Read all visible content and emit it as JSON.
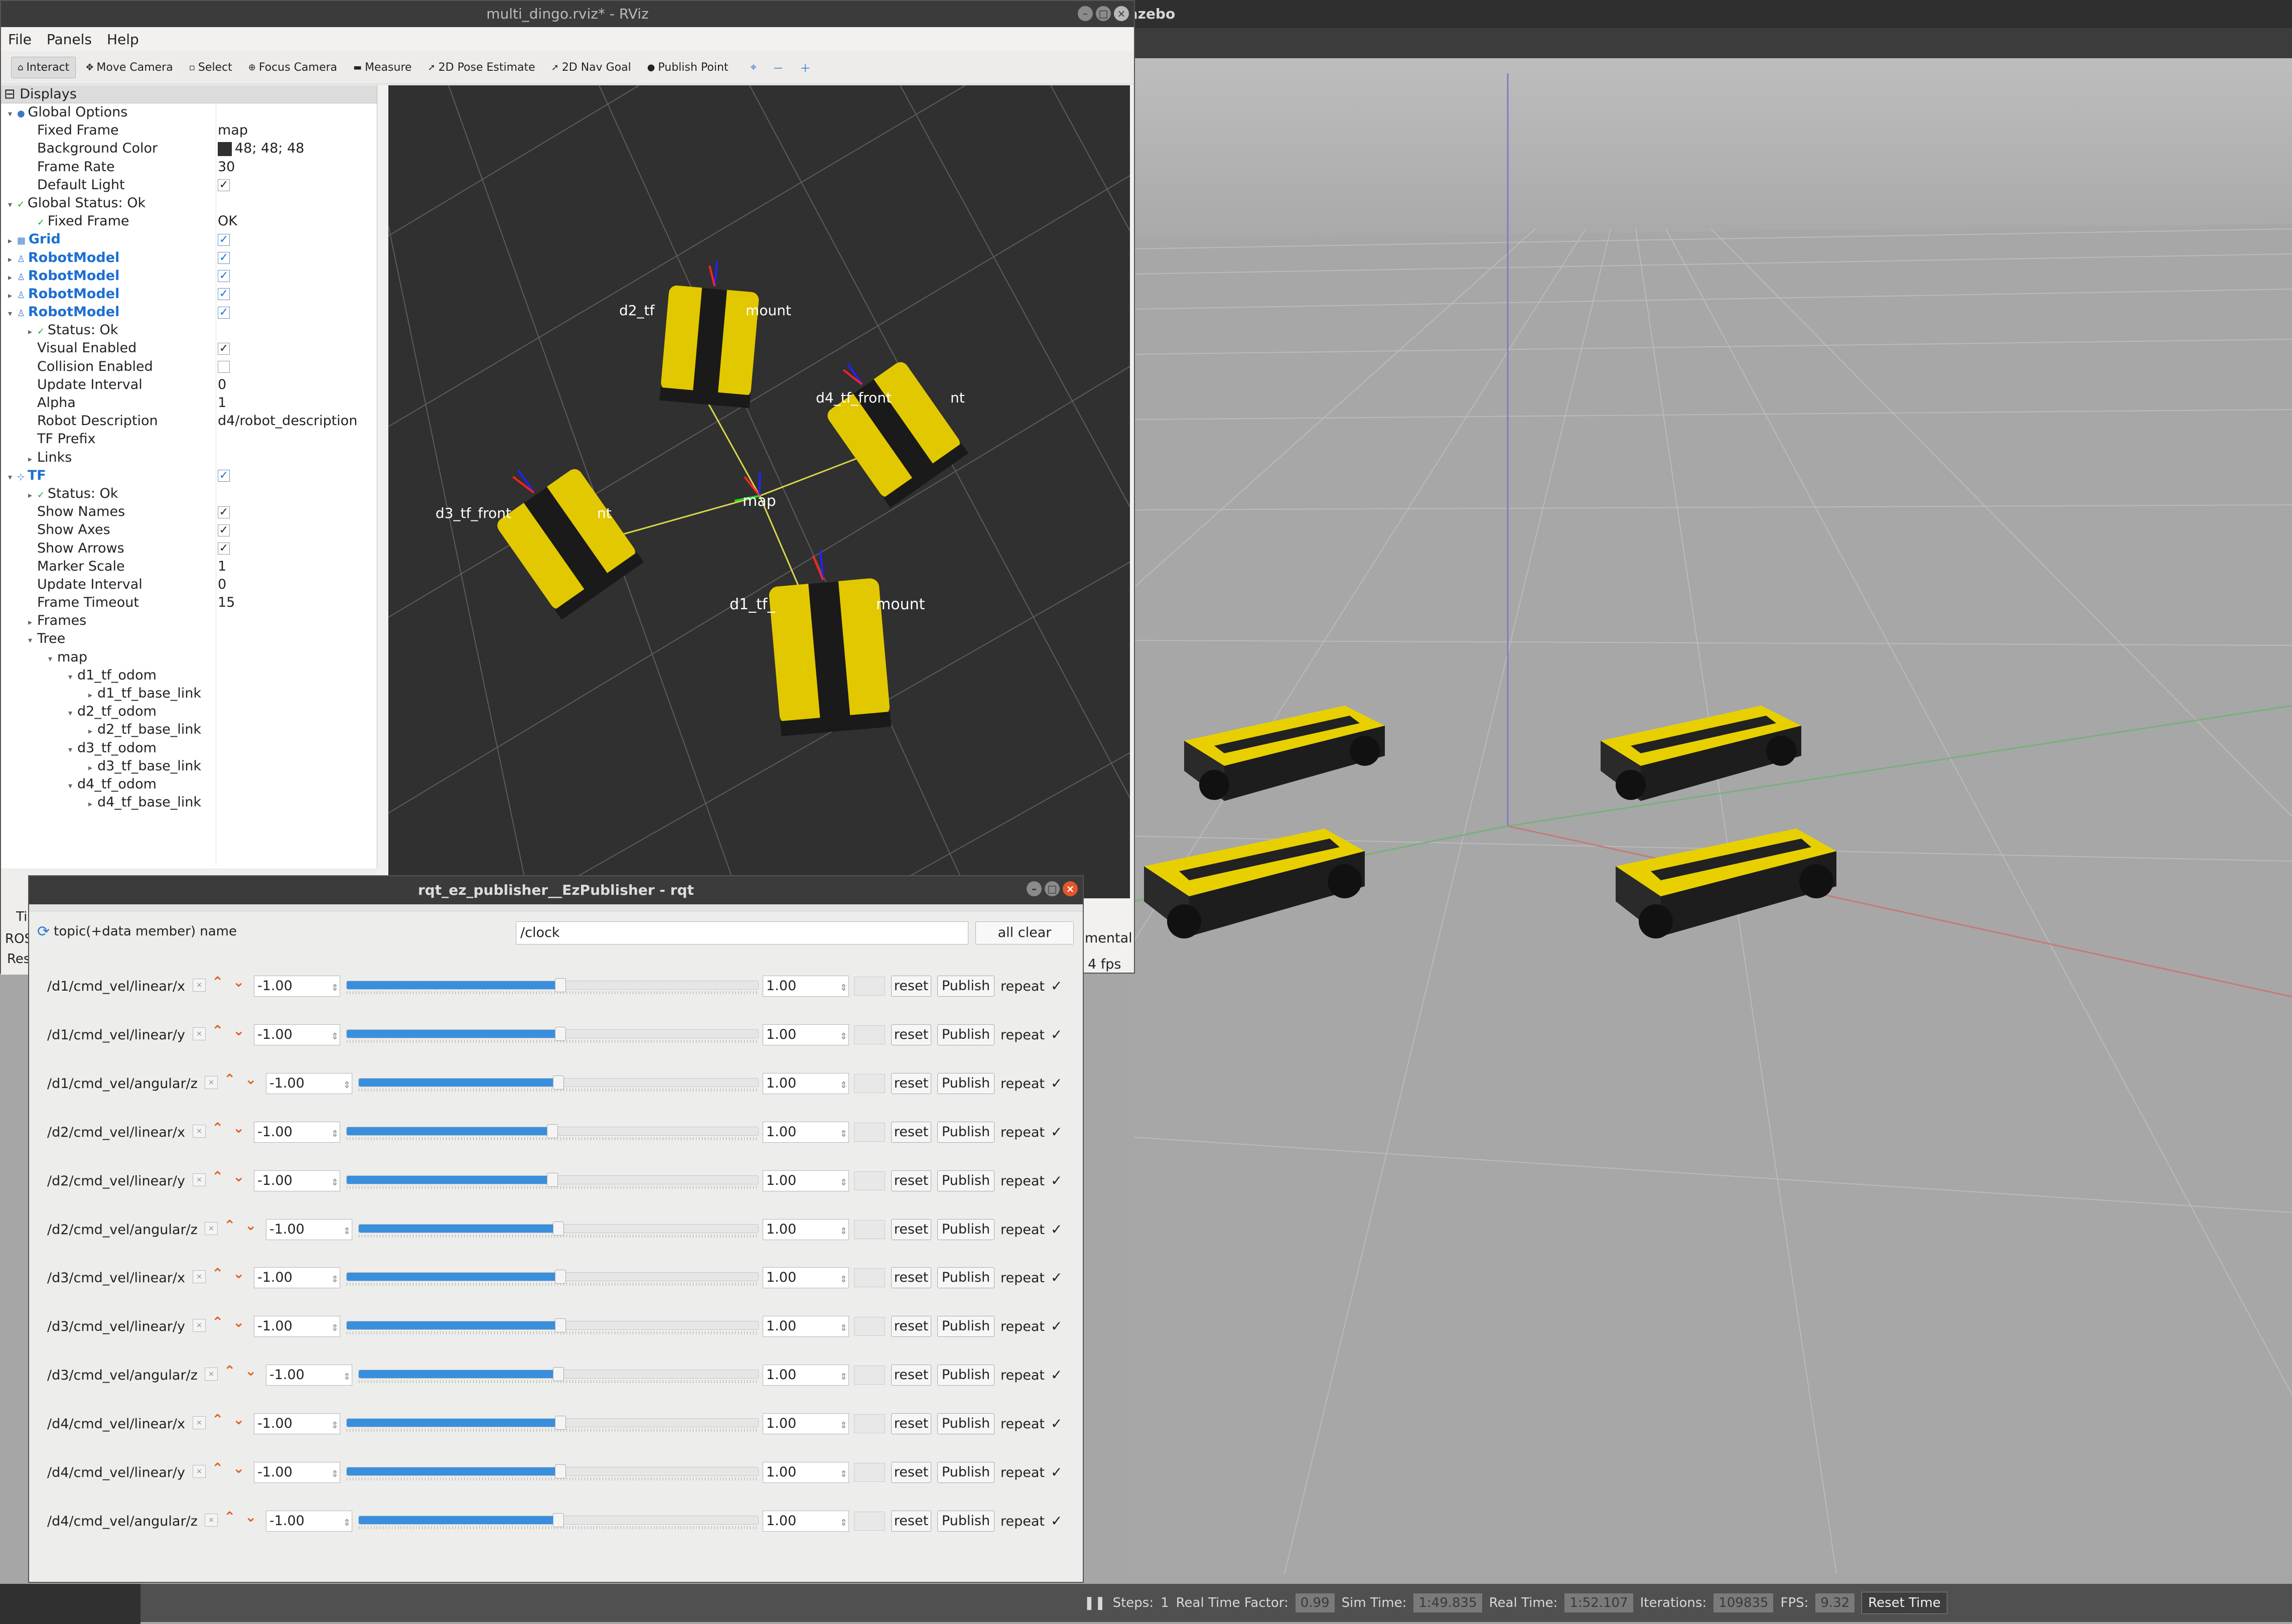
{
  "gazebo": {
    "title": "Gazebo",
    "status": {
      "steps_label": "Steps:",
      "steps_value": "1",
      "rtf_label": "Real Time Factor:",
      "rtf_value": "0.99",
      "sim_label": "Sim Time:",
      "sim_value": "1:49.835",
      "real_label": "Real Time:",
      "real_value": "1:52.107",
      "iter_label": "Iterations:",
      "iter_value": "109835",
      "fps_label": "FPS:",
      "fps_value": "9.32",
      "reset_label": "Reset Time"
    }
  },
  "rviz": {
    "title": "multi_dingo.rviz* - RViz",
    "menu": [
      "File",
      "Panels",
      "Help"
    ],
    "tools": [
      {
        "label": "Interact",
        "icon": "interact-icon",
        "glyph": "⌂"
      },
      {
        "label": "Move Camera",
        "icon": "move-camera-icon",
        "glyph": "✥"
      },
      {
        "label": "Select",
        "icon": "select-icon",
        "glyph": "▫"
      },
      {
        "label": "Focus Camera",
        "icon": "focus-camera-icon",
        "glyph": "⊕"
      },
      {
        "label": "Measure",
        "icon": "measure-icon",
        "glyph": "▬"
      },
      {
        "label": "2D Pose Estimate",
        "icon": "pose-estimate-icon",
        "glyph": "➚"
      },
      {
        "label": "2D Nav Goal",
        "icon": "nav-goal-icon",
        "glyph": "➚"
      },
      {
        "label": "Publish Point",
        "icon": "publish-point-icon",
        "glyph": "●"
      }
    ],
    "displays_title": "Displays",
    "displays": [
      {
        "k": "Global Options",
        "v": "",
        "indent": 0,
        "tri": "▾",
        "ico": "●"
      },
      {
        "k": "Fixed Frame",
        "v": "map",
        "indent": 2
      },
      {
        "k": "Background Color",
        "v": "48; 48; 48",
        "indent": 2,
        "swatch": true
      },
      {
        "k": "Frame Rate",
        "v": "30",
        "indent": 2
      },
      {
        "k": "Default Light",
        "v": "",
        "indent": 2,
        "check": true
      },
      {
        "k": "Global Status: Ok",
        "v": "",
        "indent": 0,
        "tri": "▾",
        "ico": "✓"
      },
      {
        "k": "Fixed Frame",
        "v": "OK",
        "indent": 2,
        "ico": "✓"
      },
      {
        "k": "Grid",
        "v": "",
        "indent": 0,
        "tri": "▸",
        "ico": "▦",
        "blue": true,
        "check": true
      },
      {
        "k": "RobotModel",
        "v": "",
        "indent": 0,
        "tri": "▸",
        "ico": "♙",
        "blue": true,
        "check": true
      },
      {
        "k": "RobotModel",
        "v": "",
        "indent": 0,
        "tri": "▸",
        "ico": "♙",
        "blue": true,
        "check": true
      },
      {
        "k": "RobotModel",
        "v": "",
        "indent": 0,
        "tri": "▸",
        "ico": "♙",
        "blue": true,
        "check": true
      },
      {
        "k": "RobotModel",
        "v": "",
        "indent": 0,
        "tri": "▾",
        "ico": "♙",
        "blue": true,
        "check": true
      },
      {
        "k": "Status: Ok",
        "v": "",
        "indent": 2,
        "tri": "▸",
        "ico": "✓"
      },
      {
        "k": "Visual Enabled",
        "v": "",
        "indent": 2,
        "check": true
      },
      {
        "k": "Collision Enabled",
        "v": "",
        "indent": 2,
        "check": false
      },
      {
        "k": "Update Interval",
        "v": "0",
        "indent": 2
      },
      {
        "k": "Alpha",
        "v": "1",
        "indent": 2
      },
      {
        "k": "Robot Description",
        "v": "d4/robot_description",
        "indent": 2
      },
      {
        "k": "TF Prefix",
        "v": "",
        "indent": 2
      },
      {
        "k": "Links",
        "v": "",
        "indent": 2,
        "tri": "▸"
      },
      {
        "k": "TF",
        "v": "",
        "indent": 0,
        "tri": "▾",
        "ico": "⊹",
        "blue": true,
        "check": true
      },
      {
        "k": "Status: Ok",
        "v": "",
        "indent": 2,
        "tri": "▸",
        "ico": "✓"
      },
      {
        "k": "Show Names",
        "v": "",
        "indent": 2,
        "check": true
      },
      {
        "k": "Show Axes",
        "v": "",
        "indent": 2,
        "check": true
      },
      {
        "k": "Show Arrows",
        "v": "",
        "indent": 2,
        "check": true
      },
      {
        "k": "Marker Scale",
        "v": "1",
        "indent": 2
      },
      {
        "k": "Update Interval",
        "v": "0",
        "indent": 2
      },
      {
        "k": "Frame Timeout",
        "v": "15",
        "indent": 2
      },
      {
        "k": "Frames",
        "v": "",
        "indent": 2,
        "tri": "▸"
      },
      {
        "k": "Tree",
        "v": "",
        "indent": 2,
        "tri": "▾"
      },
      {
        "k": "map",
        "v": "",
        "indent": 4,
        "tri": "▾"
      },
      {
        "k": "d1_tf_odom",
        "v": "",
        "indent": 6,
        "tri": "▾"
      },
      {
        "k": "d1_tf_base_link",
        "v": "",
        "indent": 8,
        "tri": "▸"
      },
      {
        "k": "d2_tf_odom",
        "v": "",
        "indent": 6,
        "tri": "▾"
      },
      {
        "k": "d2_tf_base_link",
        "v": "",
        "indent": 8,
        "tri": "▸"
      },
      {
        "k": "d3_tf_odom",
        "v": "",
        "indent": 6,
        "tri": "▾"
      },
      {
        "k": "d3_tf_base_link",
        "v": "",
        "indent": 8,
        "tri": "▸"
      },
      {
        "k": "d4_tf_odom",
        "v": "",
        "indent": 6,
        "tri": "▾"
      },
      {
        "k": "d4_tf_base_link",
        "v": "",
        "indent": 8,
        "tri": "▸"
      }
    ],
    "viewport_labels": {
      "map": "map",
      "d1": "d1_tf_",
      "d1_suffix": "mount",
      "d2": "d2_tf",
      "d2_suffix": "mount",
      "d3": "d3_tf_front",
      "d3_suffix": "nt",
      "d4": "d4_tf_front",
      "d4_suffix": "nt"
    },
    "bottom_fragments": {
      "a": "Ti",
      "b": "ROS",
      "c": "Res",
      "d": "mental",
      "e": "4 fps"
    }
  },
  "rqt": {
    "title": "rqt_ez_publisher__EzPublisher - rqt",
    "topic_label": "topic(+data member) name",
    "topic_value": "/clock",
    "all_clear": "all clear",
    "reset_label": "reset",
    "publish_label": "Publish",
    "repeat_label": "repeat",
    "rows": [
      {
        "topic": "/d1/cmd_vel/linear/x",
        "min": "-1.00",
        "max": "1.00",
        "value": 0.52
      },
      {
        "topic": "/d1/cmd_vel/linear/y",
        "min": "-1.00",
        "max": "1.00",
        "value": 0.52
      },
      {
        "topic": "/d1/cmd_vel/angular/z",
        "min": "-1.00",
        "max": "1.00",
        "value": 0.5
      },
      {
        "topic": "/d2/cmd_vel/linear/x",
        "min": "-1.00",
        "max": "1.00",
        "value": 0.5
      },
      {
        "topic": "/d2/cmd_vel/linear/y",
        "min": "-1.00",
        "max": "1.00",
        "value": 0.5
      },
      {
        "topic": "/d2/cmd_vel/angular/z",
        "min": "-1.00",
        "max": "1.00",
        "value": 0.5
      },
      {
        "topic": "/d3/cmd_vel/linear/x",
        "min": "-1.00",
        "max": "1.00",
        "value": 0.52
      },
      {
        "topic": "/d3/cmd_vel/linear/y",
        "min": "-1.00",
        "max": "1.00",
        "value": 0.52
      },
      {
        "topic": "/d3/cmd_vel/angular/z",
        "min": "-1.00",
        "max": "1.00",
        "value": 0.5
      },
      {
        "topic": "/d4/cmd_vel/linear/x",
        "min": "-1.00",
        "max": "1.00",
        "value": 0.52
      },
      {
        "topic": "/d4/cmd_vel/linear/y",
        "min": "-1.00",
        "max": "1.00",
        "value": 0.52
      },
      {
        "topic": "/d4/cmd_vel/angular/z",
        "min": "-1.00",
        "max": "1.00",
        "value": 0.5
      }
    ]
  },
  "colors": {
    "slider_fill": "#3a8fdc",
    "arrow": "#e0641c",
    "robot_yellow": "#e8d000",
    "rviz_bg": "#303030"
  }
}
